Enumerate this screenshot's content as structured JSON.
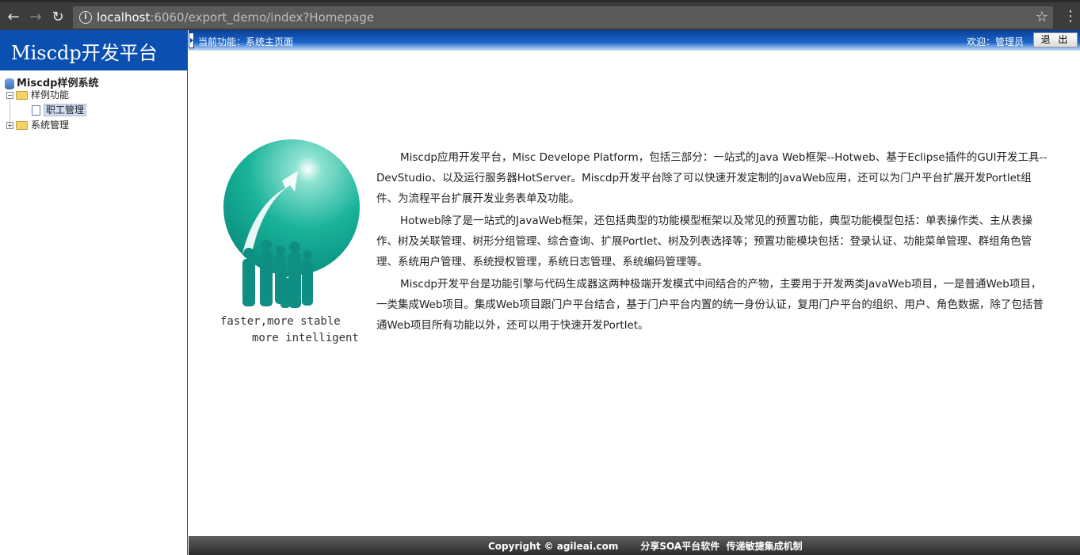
{
  "browser": {
    "url_host": "localhost",
    "url_rest": ":6060/export_demo/index?Homepage"
  },
  "sidebar": {
    "title": "Miscdp开发平台",
    "root": "Miscdp样例系统",
    "items": [
      {
        "label": "样例功能",
        "expanded": true,
        "children": [
          {
            "label": "职工管理",
            "selected": true
          }
        ]
      },
      {
        "label": "系统管理",
        "expanded": false,
        "children": []
      }
    ]
  },
  "topbar": {
    "breadcrumb": "当前功能：系统主页面",
    "welcome": "欢迎：管理员",
    "logout_label": "退 出"
  },
  "logo": {
    "slogan_line1": "faster,more stable",
    "slogan_line2": "more intelligent",
    "colors": {
      "sphere": "#19b39a",
      "arrow": "#ffffff",
      "people": "#0f8f84"
    }
  },
  "content": {
    "paragraphs": [
      "Miscdp应用开发平台，Misc Develope Platform，包括三部分：一站式的Java Web框架--Hotweb、基于Eclipse插件的GUI开发工具--DevStudio、以及运行服务器HotServer。Miscdp开发平台除了可以快速开发定制的JavaWeb应用，还可以为门户平台扩展开发Portlet组件、为流程平台扩展开发业务表单及功能。",
      "Hotweb除了是一站式的JavaWeb框架，还包括典型的功能模型框架以及常见的预置功能，典型功能模型包括：单表操作类、主从表操作、树及关联管理、树形分组管理、综合查询、扩展Portlet、树及列表选择等；预置功能模块包括：登录认证、功能菜单管理、群组角色管理、系统用户管理、系统授权管理，系统日志管理、系统编码管理等。",
      "Miscdp开发平台是功能引擎与代码生成器这两种极端开发模式中间结合的产物，主要用于开发两类JavaWeb项目，一是普通Web项目，一类集成Web项目。集成Web项目跟门户平台结合，基于门户平台内置的统一身份认证，复用门户平台的组织、用户、角色数据，除了包括普通Web项目所有功能以外，还可以用于快速开发Portlet。"
    ]
  },
  "footer": {
    "copyright": "Copyright © agileai.com",
    "slogan": "分享SOA平台软件  传递敏捷集成机制"
  },
  "colors": {
    "header_blue": "#0b4fb0",
    "footer_gray": "#3a3a3a"
  }
}
